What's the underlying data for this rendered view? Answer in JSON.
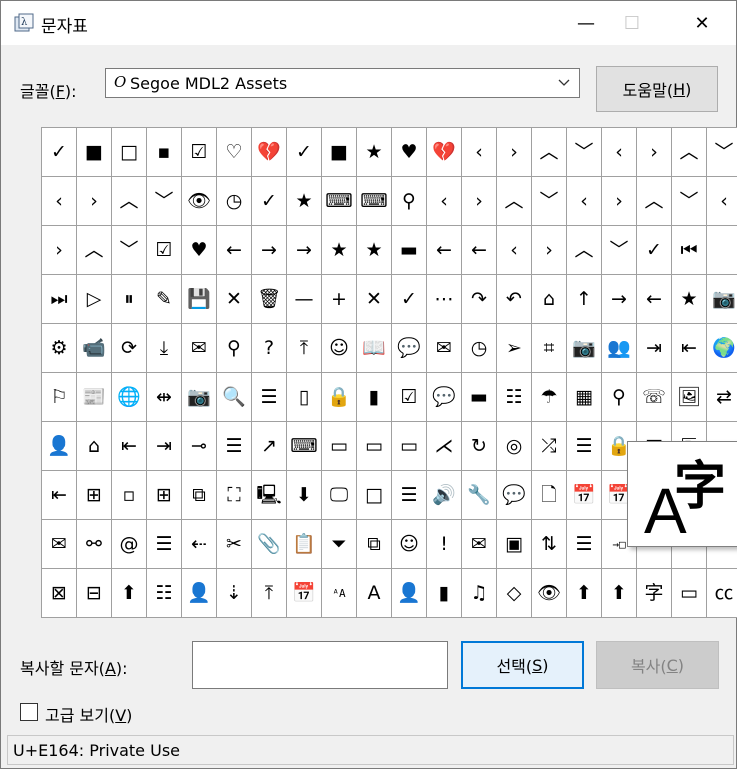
{
  "window": {
    "title": "문자표",
    "minimize_glyph": "—",
    "maximize_glyph": "☐",
    "close_glyph": "✕"
  },
  "font": {
    "label_text": "글꼴(",
    "label_key": "F",
    "label_end": "):",
    "selected": "Segoe MDL2 Assets",
    "font_glyph": "O"
  },
  "help_button": {
    "text": "도움말(",
    "key": "H",
    "end": ")"
  },
  "grid": {
    "cols": 20,
    "rows": 10,
    "cells": [
      [
        "✓",
        "■",
        "□",
        "▪",
        "☑",
        "♡",
        "💔",
        "✓",
        "■",
        "★",
        "♥",
        "💔",
        "‹",
        "›",
        "︿",
        "﹀",
        "‹",
        "›",
        "︿",
        "﹀"
      ],
      [
        "‹",
        "›",
        "︿",
        "﹀",
        "👁",
        "◷",
        "✓",
        "★",
        "⌨",
        "⌨",
        "⚲",
        "‹",
        "›",
        "︿",
        "﹀",
        "‹",
        "›",
        "︿",
        "﹀",
        "‹"
      ],
      [
        "›",
        "︿",
        "﹀",
        "☑",
        "♥",
        "←",
        "→",
        "→",
        "★",
        "★",
        "▬",
        "←",
        "←",
        "‹",
        "›",
        "︿",
        "﹀",
        "✓",
        "⏮",
        ""
      ],
      [
        "⏭",
        "▷",
        "⏸",
        "✎",
        "💾",
        "✕",
        "🗑",
        "—",
        "+",
        "✕",
        "✓",
        "⋯",
        "↷",
        "↶",
        "⌂",
        "↑",
        "→",
        "←",
        "★",
        "📷"
      ],
      [
        "⚙",
        "📹",
        "⟳",
        "⤓",
        "✉",
        "⚲",
        "?",
        "⤒",
        "☺",
        "📖",
        "💬",
        "✉",
        "◷",
        "➢",
        "⌗",
        "📷",
        "👥",
        "⇥",
        "⇤",
        "🌍"
      ],
      [
        "⚐",
        "📰",
        "🌐",
        "⇹",
        "📷",
        "🔍",
        "☰",
        "▯",
        "🔒",
        "▮",
        "☑",
        "💬",
        "▬",
        "☷",
        "☂",
        "▦",
        "⚲",
        "☏",
        "🖼",
        "⇄"
      ],
      [
        "👤",
        "⌂",
        "⇤",
        "⇥",
        "⊸",
        "☰",
        "↗",
        "⌨",
        "▭",
        "▭",
        "▭",
        "⋌",
        "↻",
        "◎",
        "⤮",
        "☰",
        "🔒",
        "▦",
        "⇱",
        ""
      ],
      [
        "⇤",
        "⊞",
        "▫",
        "⊞",
        "⧉",
        "⛶",
        "🖳",
        "⬇",
        "🖵",
        "□",
        "☰",
        "🔊",
        "🔧",
        "💬",
        "🗋",
        "📅",
        "📅",
        "",
        "",
        ""
      ],
      [
        "✉",
        "⚯",
        "@",
        "☰",
        "⇠",
        "✂",
        "📎",
        "📋",
        "⏷",
        "⧉",
        "☺",
        "!",
        "✉",
        "▣",
        "⇅",
        "☰",
        "→□",
        "",
        "",
        ""
      ],
      [
        "⊠",
        "⊟",
        "⬆",
        "☷",
        "👤",
        "⇣",
        "⤒",
        "📅",
        "ᴬA",
        "A",
        "👤",
        "▮",
        "♫",
        "◇",
        "👁",
        "⬆",
        "⬆",
        "字",
        "▭",
        "㏄"
      ]
    ]
  },
  "zoom": {
    "latin": "A",
    "cjk": "字"
  },
  "copy": {
    "label_text": "복사할 문자(",
    "label_key": "A",
    "label_end": "):",
    "value": ""
  },
  "select_button": {
    "text": "선택(",
    "key": "S",
    "end": ")"
  },
  "copy_button": {
    "text": "복사(",
    "key": "C",
    "end": ")"
  },
  "advanced": {
    "text": "고급 보기(",
    "key": "V",
    "end": ")",
    "checked": false
  },
  "status": {
    "text": "U+E164: Private Use"
  }
}
